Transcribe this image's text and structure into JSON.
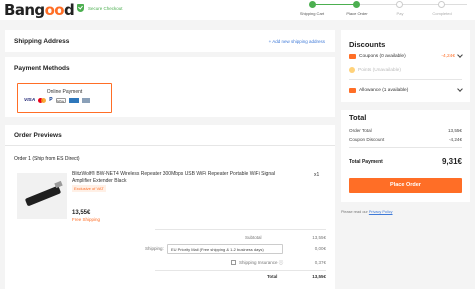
{
  "header": {
    "logo_pre": "Bang",
    "logo_oo": "oo",
    "logo_post": "d",
    "secure": "Secure Checkout",
    "steps": [
      {
        "label": "Shipping Cart",
        "state": "done"
      },
      {
        "label": "Place Order",
        "state": "current"
      },
      {
        "label": "Pay",
        "state": "todo"
      },
      {
        "label": "Completed",
        "state": "todo"
      }
    ]
  },
  "shipping": {
    "title": "Shipping Address",
    "add_link": "+ Add new shipping address"
  },
  "payment": {
    "title": "Payment Methods",
    "option_label": "Online Payment",
    "icons": [
      "visa-icon",
      "mastercard-icon",
      "paypal-icon",
      "gpay-icon",
      "amex-icon",
      "bank-icon"
    ],
    "visa_text": "VISA",
    "paypal_text": "P",
    "gpay_text": "GPay"
  },
  "order": {
    "title": "Order Previews",
    "order_label": "Order 1 (Ship from ES Direct)",
    "product": {
      "title": "BlitzWolf® BW-NET4 Wireless Repeater 300Mbps USB WiFi Repeater Portable WiFi Signal Amplifier Extender Black",
      "tag": "Exclusive of VAT",
      "qty": "x1",
      "price": "13,55€",
      "shipping_note": "Free Shipping"
    },
    "summary": {
      "subtotal_label": "Subtotal",
      "subtotal_value": "13,55€",
      "shipping_label": "Shipping:",
      "shipping_option": "EU Priority Mail (Free shipping & 1-2 business days)",
      "shipping_value": "0,00€",
      "insurance_label": "Shipping Insurance ⓘ",
      "insurance_value": "0,37€",
      "total_label": "Total",
      "total_value": "13,55€"
    }
  },
  "discounts": {
    "title": "Discounts",
    "coupons_label": "Coupons (0 available)",
    "coupons_value": "-4,24€",
    "points_label": "Points (Unavailable)",
    "allowance_label": "Allowance (1 available)"
  },
  "totals": {
    "title": "Total",
    "order_total_label": "Order Total",
    "order_total_value": "13,55€",
    "coupon_discount_label": "Coupon Discount",
    "coupon_discount_value": "-4,24€",
    "total_payment_label": "Total Payment",
    "total_payment_value": "9,31€",
    "place_order": "Place Order"
  },
  "policy": {
    "prefix": "Please read our ",
    "link": "Privacy Policy"
  },
  "colors": {
    "accent": "#ff6e26",
    "success": "#4caf50",
    "link": "#3f7ad8"
  }
}
